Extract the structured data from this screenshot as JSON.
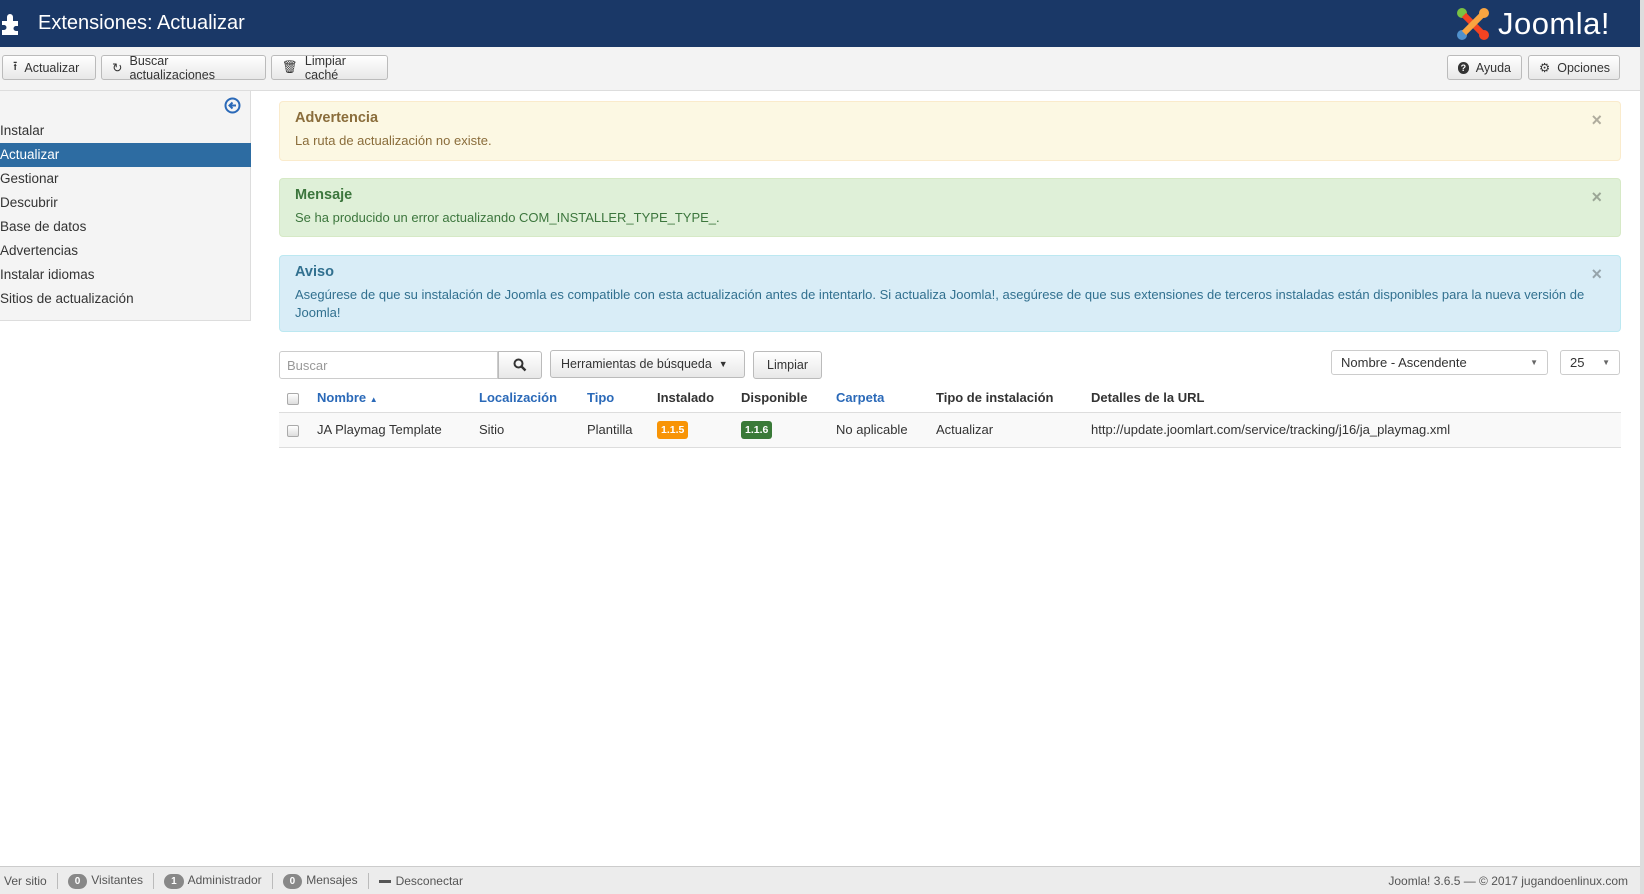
{
  "header": {
    "title": "Extensiones: Actualizar",
    "logo_text": "Joomla!"
  },
  "toolbar": {
    "update": "Actualizar",
    "find": "Buscar actualizaciones",
    "purge": "Limpiar caché",
    "help": "Ayuda",
    "options": "Opciones"
  },
  "sidebar": {
    "items": [
      {
        "label": "Instalar"
      },
      {
        "label": "Actualizar"
      },
      {
        "label": "Gestionar"
      },
      {
        "label": "Descubrir"
      },
      {
        "label": "Base de datos"
      },
      {
        "label": "Advertencias"
      },
      {
        "label": "Instalar idiomas"
      },
      {
        "label": "Sitios de actualización"
      }
    ]
  },
  "alerts": {
    "warning": {
      "title": "Advertencia",
      "text": "La ruta de actualización no existe."
    },
    "message": {
      "title": "Mensaje",
      "text": "Se ha producido un error actualizando COM_INSTALLER_TYPE_TYPE_."
    },
    "notice": {
      "title": "Aviso",
      "text": "Asegúrese de que su instalación de Joomla es compatible con esta actualización antes de intentarlo. Si actualiza Joomla!, asegúrese de que sus extensiones de terceros instaladas están disponibles para la nueva versión de Joomla!"
    }
  },
  "filters": {
    "search_placeholder": "Buscar",
    "tools": "Herramientas de búsqueda",
    "clear": "Limpiar",
    "ordering": "Nombre - Ascendente",
    "limit": "25"
  },
  "table": {
    "headers": [
      "Nombre",
      "Localización",
      "Tipo",
      "Instalado",
      "Disponible",
      "Carpeta",
      "Tipo de instalación",
      "Detalles de la URL"
    ],
    "rows": [
      {
        "name": "JA Playmag Template",
        "location": "Sitio",
        "type": "Plantilla",
        "installed": "1.1.5",
        "available": "1.1.6",
        "folder": "No aplicable",
        "install_type": "Actualizar",
        "url": "http://update.joomlart.com/service/tracking/j16/ja_playmag.xml"
      }
    ]
  },
  "footer": {
    "view_site": "Ver sitio",
    "visitors_count": "0",
    "visitors": "Visitantes",
    "admin_count": "1",
    "admin": "Administrador",
    "messages_count": "0",
    "messages": "Mensajes",
    "logout": "Desconectar",
    "version": "Joomla! 3.6.5 — © 2017 jugandoenlinux.com"
  },
  "colors": {
    "header": "#1a3867",
    "active": "#2d6ca2",
    "installed_badge": "#f89406",
    "available_badge": "#3a7a38"
  }
}
